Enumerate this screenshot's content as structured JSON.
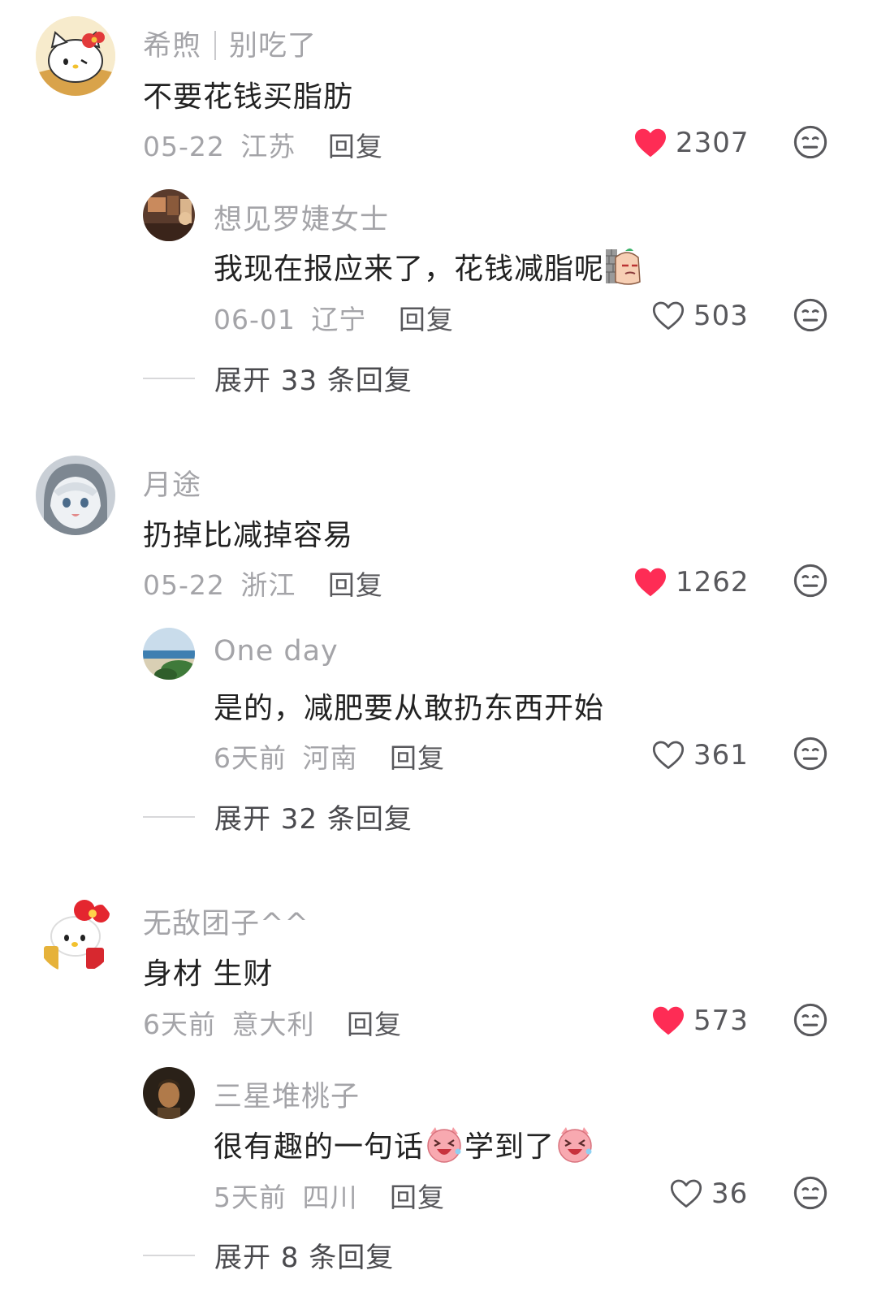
{
  "comments": [
    {
      "user": "希煦",
      "user_tag": "别吃了",
      "text": "不要花钱买脂肪",
      "date": "05-22",
      "location": "江苏",
      "reply_label": "回复",
      "likes": "2307",
      "liked": true,
      "reply": {
        "user": "想见罗婕女士",
        "text": "我现在报应来了，花钱减脂呢",
        "date": "06-01",
        "location": "辽宁",
        "reply_label": "回复",
        "likes": "503",
        "liked": false
      },
      "expand_label": "展开 33 条回复"
    },
    {
      "user": "月途",
      "text": "扔掉比减掉容易",
      "date": "05-22",
      "location": "浙江",
      "reply_label": "回复",
      "likes": "1262",
      "liked": true,
      "reply": {
        "user": "One day",
        "text": "是的，减肥要从敢扔东西开始",
        "date": "6天前",
        "location": "河南",
        "reply_label": "回复",
        "likes": "361",
        "liked": false
      },
      "expand_label": "展开 32 条回复"
    },
    {
      "user": "无敌团子^^",
      "text": "身材 生财",
      "date": "6天前",
      "location": "意大利",
      "reply_label": "回复",
      "likes": "573",
      "liked": true,
      "reply": {
        "user": "三星堆桃子",
        "text_parts": [
          "很有趣的一句话",
          "学到了"
        ],
        "date": "5天前",
        "location": "四川",
        "reply_label": "回复",
        "likes": "36",
        "liked": false
      },
      "expand_label": "展开 8 条回复"
    }
  ],
  "colors": {
    "liked_heart": "#fe2c55",
    "muted_text": "#a4a4a8"
  },
  "icons": [
    "heart-filled-icon",
    "heart-outline-icon",
    "dislike-face-icon"
  ]
}
